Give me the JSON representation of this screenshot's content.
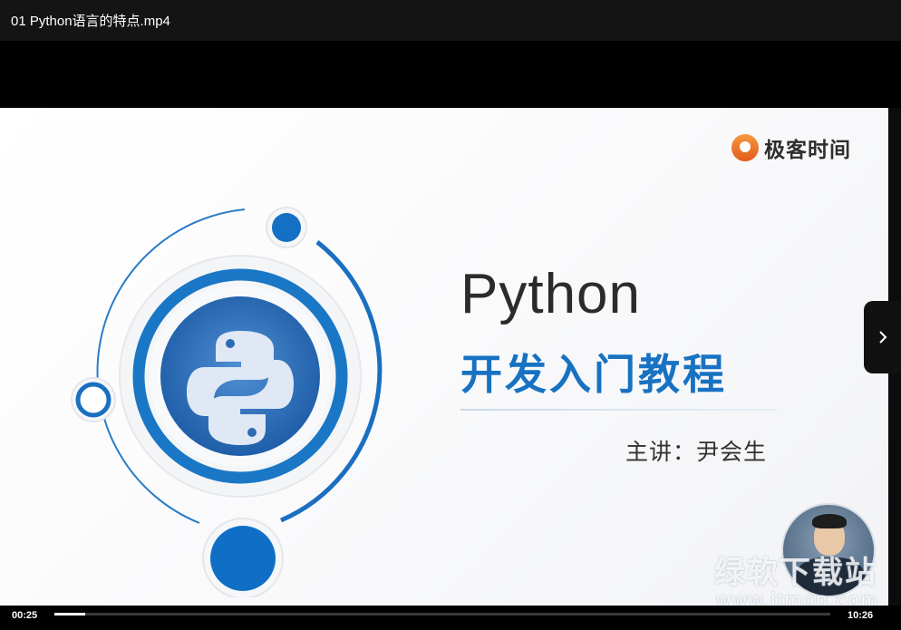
{
  "window": {
    "title": "01  Python语言的特点.mp4"
  },
  "slide": {
    "brand": "极客时间",
    "brand_logo_icon": "geektime-logo-icon",
    "title": "Python",
    "subtitle": "开发入门教程",
    "lecturer": "主讲：尹会生",
    "python_logo_icon": "python-logo-icon",
    "accent_color": "#1872c2"
  },
  "watermark": {
    "text": "绿软下载站",
    "url": "www.itmop.com"
  },
  "player": {
    "current_time": "00:25",
    "duration": "10:26",
    "progress_fraction": 0.04,
    "next_icon": "chevron-right-icon"
  }
}
